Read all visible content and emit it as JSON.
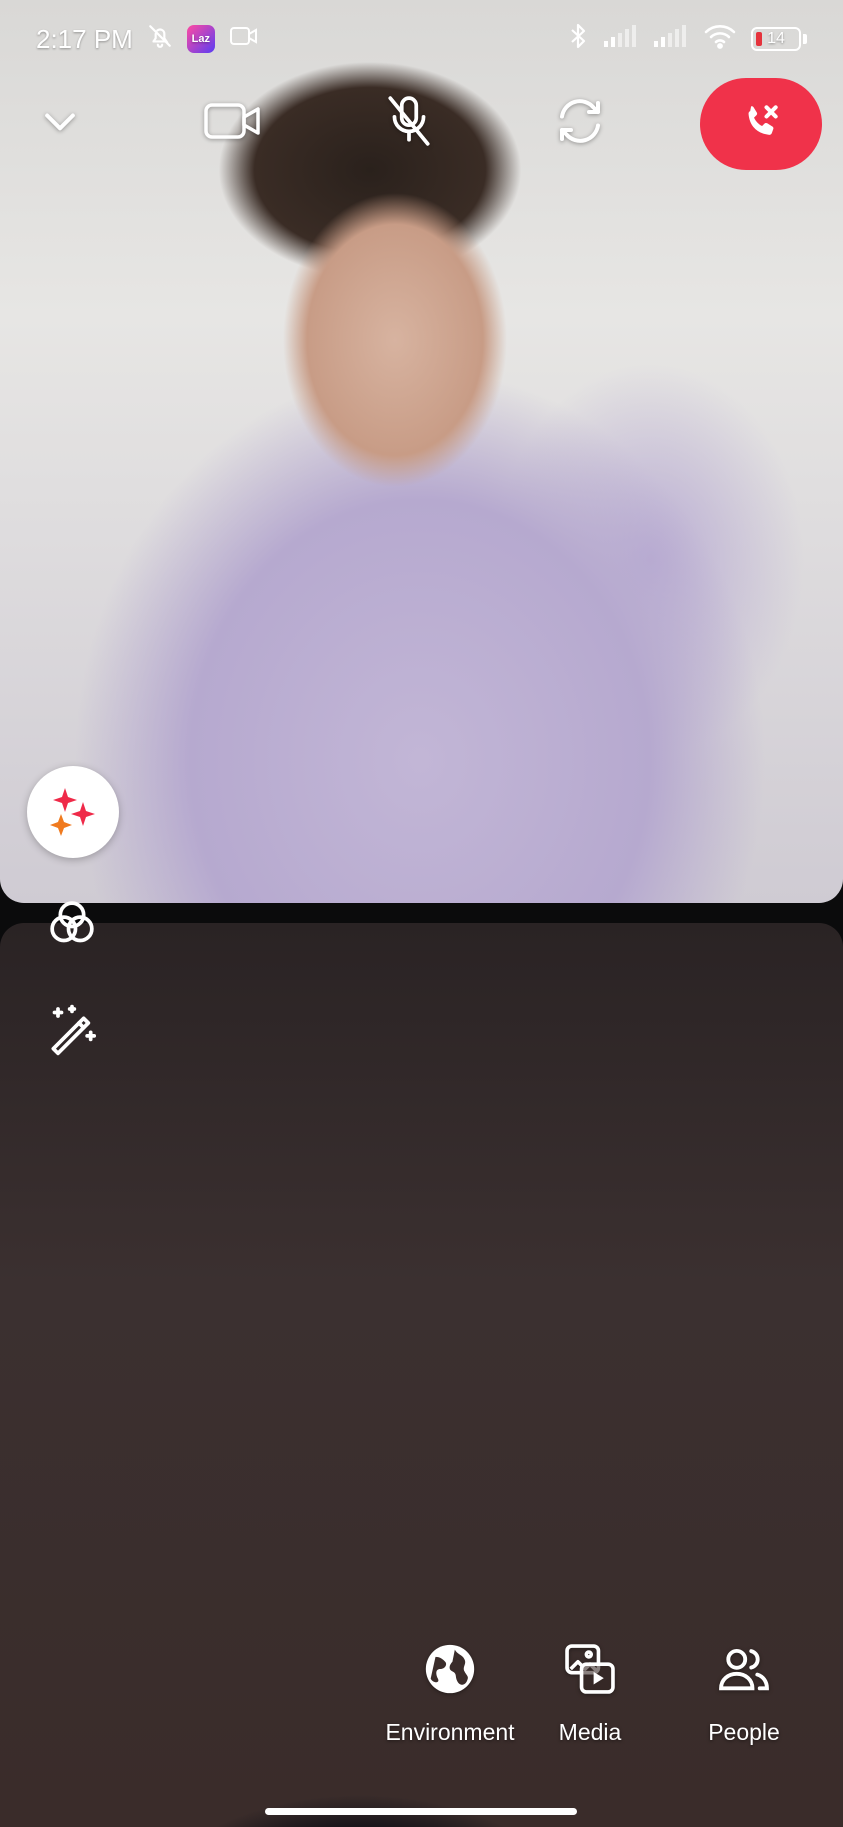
{
  "status_bar": {
    "time": "2:17 PM",
    "app_badge": "Laz",
    "battery_level": "14",
    "icons": [
      "bell-off-icon",
      "app-badge-icon",
      "screen-record-icon",
      "bluetooth-icon",
      "signal-icon",
      "signal-icon",
      "wifi-icon",
      "battery-icon"
    ]
  },
  "call_controls": {
    "icons": [
      "chevron-down-icon",
      "video-camera-icon",
      "mic-off-icon",
      "flip-camera-icon",
      "end-call-icon"
    ],
    "end_call_color": "#f0324a"
  },
  "side_tools": {
    "icons": [
      "sparkles-icon",
      "filters-icon",
      "magic-wand-icon"
    ]
  },
  "bottom_menu": {
    "environment_label": "Environment",
    "media_label": "Media",
    "people_label": "People",
    "icons": [
      "globe-icon",
      "media-icon",
      "people-icon"
    ]
  }
}
